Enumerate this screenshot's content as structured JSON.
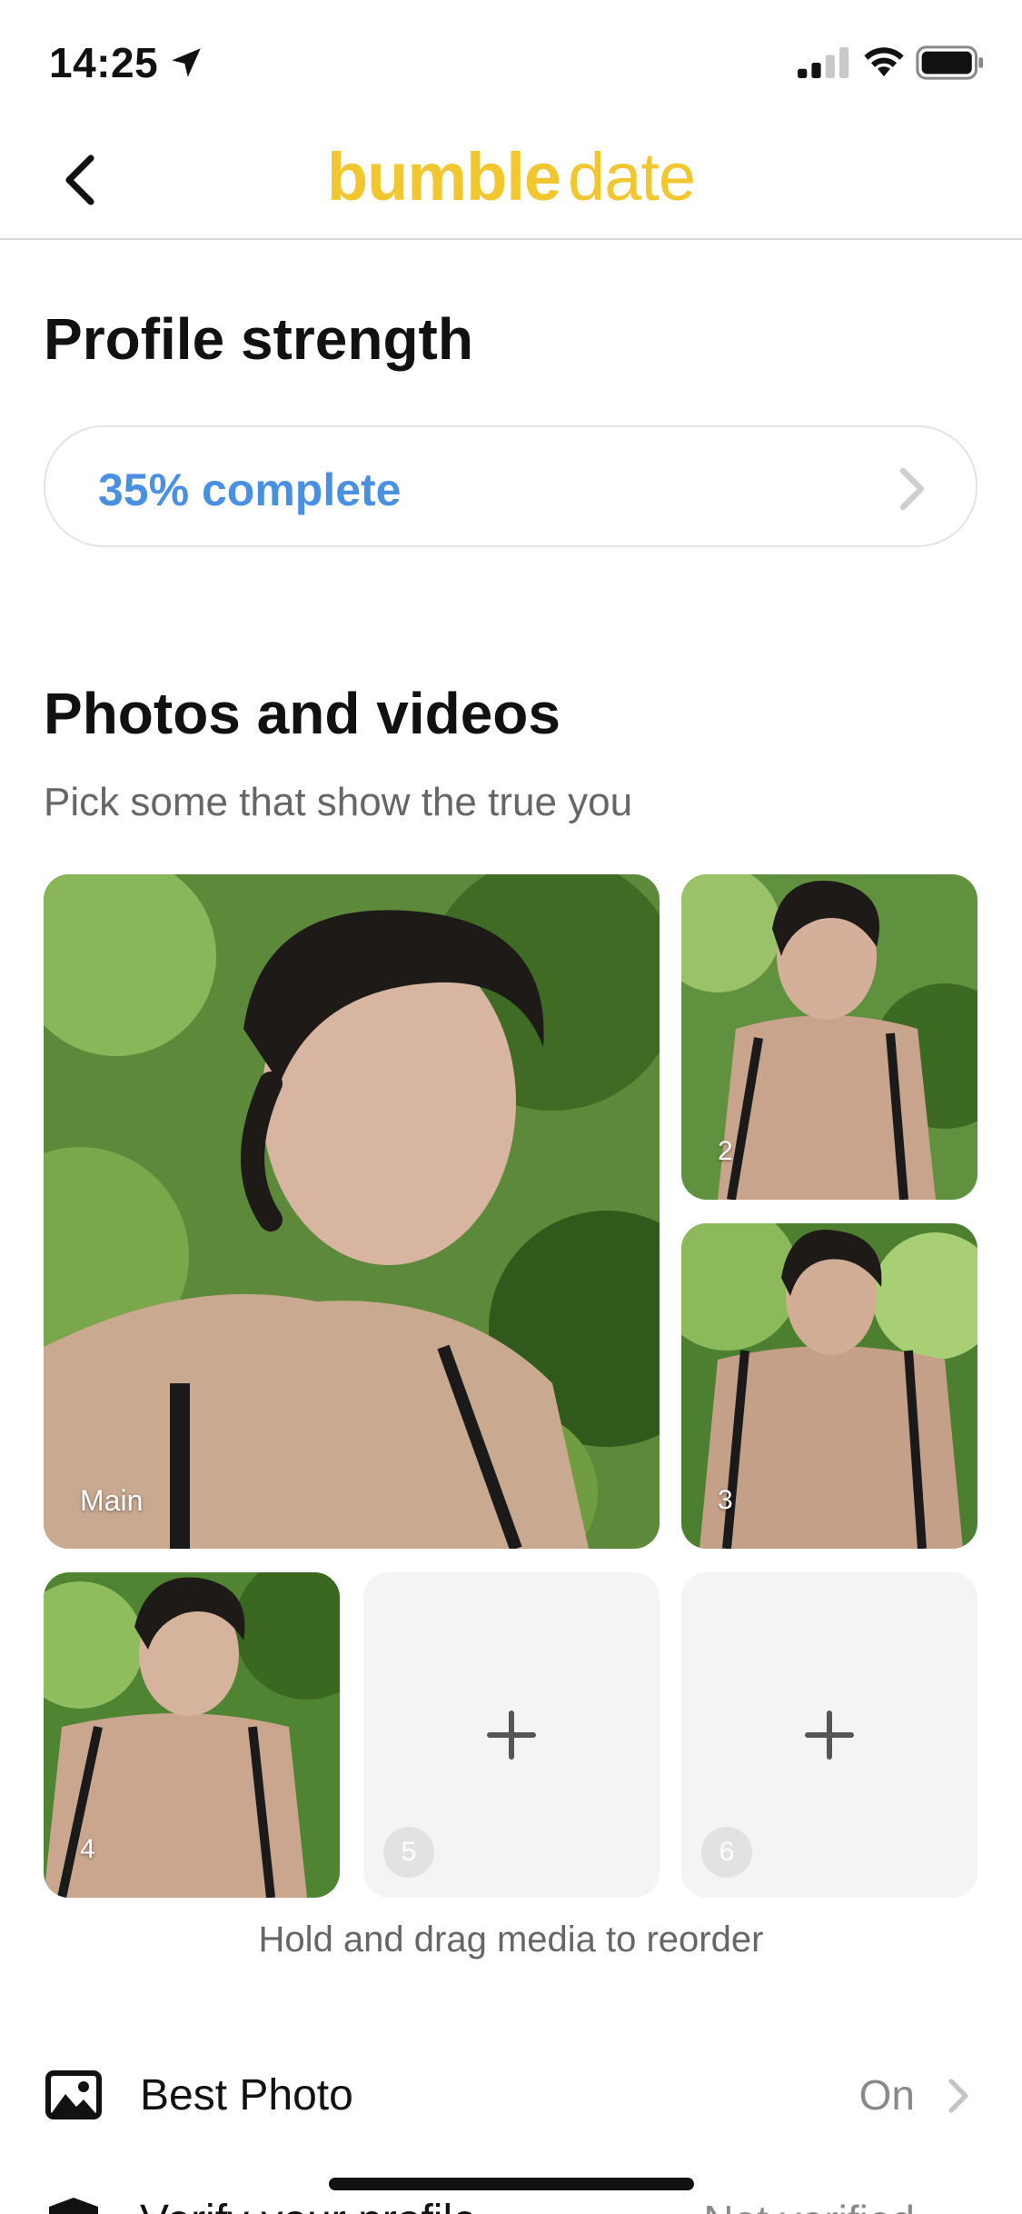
{
  "status_bar": {
    "time": "14:25",
    "icons": [
      "location-arrow-icon",
      "cellular-signal-icon",
      "wifi-icon",
      "battery-icon"
    ]
  },
  "nav": {
    "back_icon": "chevron-left-icon",
    "brand_primary": "bumble",
    "brand_secondary": "date",
    "brand_color": "#f1c62f"
  },
  "profile_strength": {
    "heading": "Profile strength",
    "progress_text": "35% complete",
    "progress_value": 0.35,
    "accent_color": "#4a90e2"
  },
  "photos": {
    "heading": "Photos and videos",
    "subtitle": "Pick some that show the true you",
    "tiles": [
      {
        "label": "Main",
        "filled": true
      },
      {
        "label": "2",
        "filled": true
      },
      {
        "label": "3",
        "filled": true
      },
      {
        "label": "4",
        "filled": true
      },
      {
        "label": "5",
        "filled": false
      },
      {
        "label": "6",
        "filled": false
      }
    ],
    "hint": "Hold and drag media to reorder"
  },
  "settings": [
    {
      "label": "Best Photo",
      "value": "On",
      "icon": "image-icon"
    },
    {
      "label": "Verify your profile",
      "value": "Not verified",
      "icon": "shield-icon"
    }
  ]
}
